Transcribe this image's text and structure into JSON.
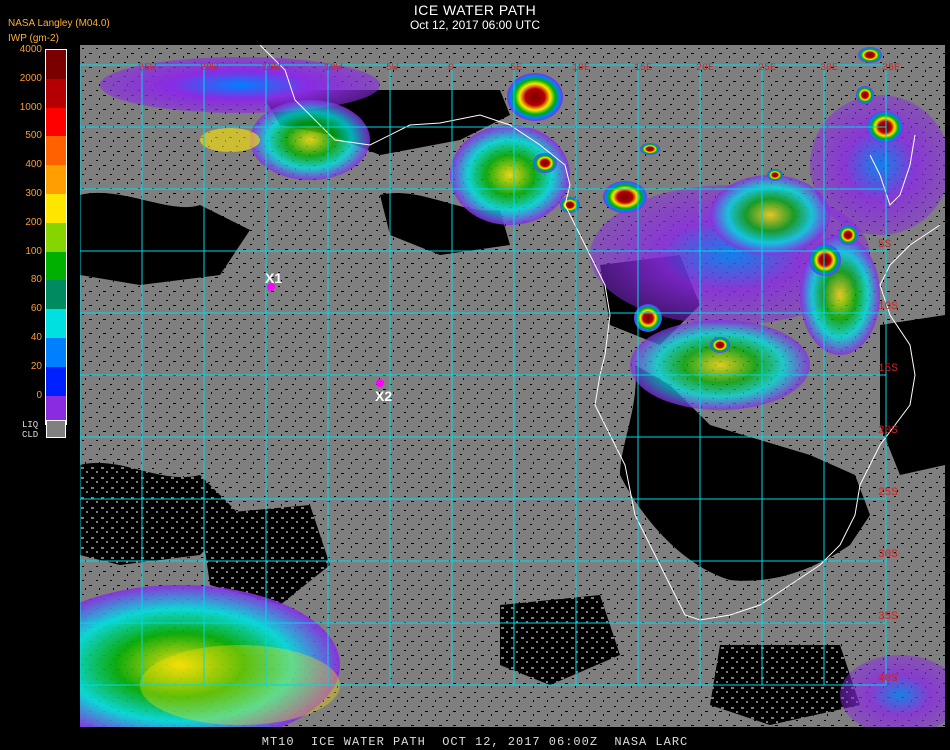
{
  "header": {
    "title": "ICE WATER PATH",
    "subtitle": "Oct 12, 2017 06:00 UTC",
    "source": "NASA Langley (M04.0)",
    "units": "IWP (gm-2)"
  },
  "legend": {
    "labels": [
      "4000",
      "2000",
      "1000",
      "500",
      "400",
      "300",
      "200",
      "100",
      "80",
      "60",
      "40",
      "20",
      "0"
    ],
    "colors": [
      "#7a0000",
      "#b40000",
      "#ff0000",
      "#ff6000",
      "#ff9e00",
      "#ffe600",
      "#86d400",
      "#00b000",
      "#008a60",
      "#00e0e0",
      "#0080ff",
      "#0020ff",
      "#8a2be2"
    ],
    "liquid_label_1": "LIQ",
    "liquid_label_2": "CLD",
    "liquid_color": "#808080"
  },
  "map": {
    "lon_labels": [
      "25W",
      "20W",
      "15W",
      "10W",
      "5W",
      "0",
      "5E",
      "10E",
      "15E",
      "20E",
      "25E",
      "30E",
      "35E"
    ],
    "lat_labels": [
      "5S",
      "10S",
      "15S",
      "20S",
      "25S",
      "30S",
      "35S",
      "40S"
    ],
    "grid_color": "#00d8e8",
    "label_color": "#d42020",
    "coast_color": "#ffffff",
    "markers": [
      {
        "id": "X1",
        "label": "X1"
      },
      {
        "id": "X2",
        "label": "X2"
      }
    ]
  },
  "footer": "MT10  ICE WATER PATH  OCT 12, 2017 06:00Z  NASA LARC"
}
